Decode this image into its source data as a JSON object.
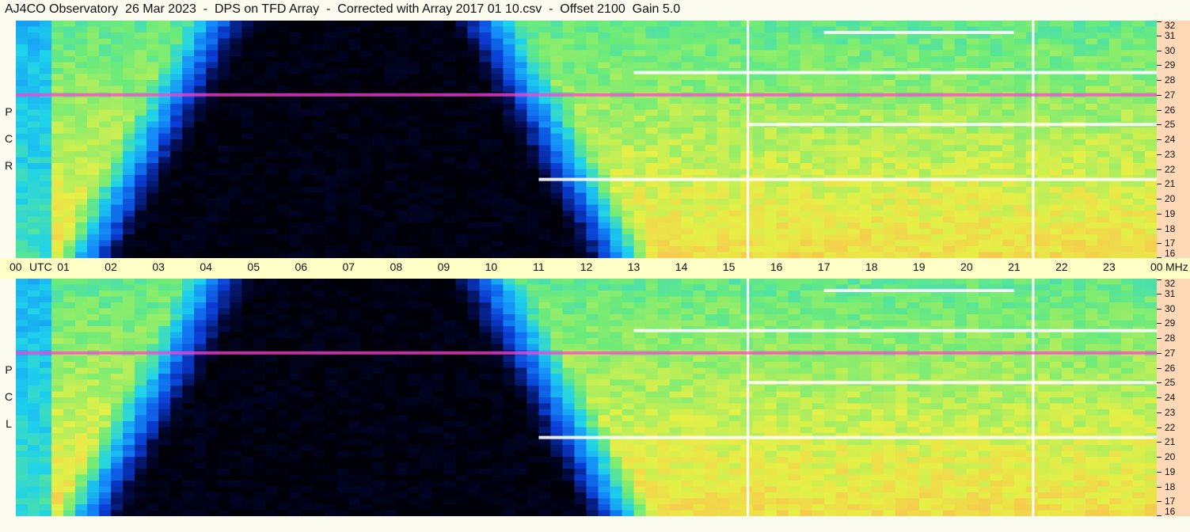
{
  "title": "AJ4CO Observatory  26 Mar 2023  -  DPS on TFD Array  -  Corrected with Array 2017 01 10.csv  -  Offset 2100  Gain 5.0",
  "colors": {
    "background": "#fbfbf0",
    "time_axis": "#ffffc8",
    "freq_axis": "#ffd8b8"
  },
  "chart_data": {
    "type": "heatmap",
    "colormap": "jet-like (black → blue → cyan → green → yellow → orange → magenta/white)",
    "x_axis": {
      "labels": [
        "00",
        "01",
        "02",
        "03",
        "04",
        "05",
        "06",
        "07",
        "08",
        "09",
        "10",
        "11",
        "12",
        "13",
        "14",
        "15",
        "16",
        "17",
        "18",
        "19",
        "20",
        "21",
        "22",
        "23",
        "00"
      ],
      "unit_label": "UTC",
      "range_hours": [
        0,
        24
      ]
    },
    "y_axis": {
      "labels": [
        "32",
        "31",
        "30",
        "29",
        "28",
        "27",
        "26",
        "25",
        "24",
        "23",
        "22",
        "21",
        "20",
        "19",
        "18",
        "17",
        "16"
      ],
      "unit_label": "MHz",
      "range_mhz": [
        16,
        32
      ]
    },
    "panels": [
      {
        "id": "rcp",
        "side_label": [
          "R",
          "C",
          "P"
        ]
      },
      {
        "id": "lcp",
        "side_label": [
          "L",
          "C",
          "P"
        ]
      }
    ],
    "features": [
      {
        "kind": "quiet_region",
        "description": "dark low-intensity region",
        "utc_start": 0.7,
        "utc_end": 13.5,
        "freq_range_mhz": [
          16,
          32
        ]
      },
      {
        "kind": "vertical_line",
        "utc": 15.4,
        "color": "white"
      },
      {
        "kind": "vertical_line",
        "utc": 21.4,
        "color": "white"
      },
      {
        "kind": "horizontal_band",
        "freq_mhz": 31.2,
        "utc_start": 17.0,
        "utc_end": 21.0,
        "color": "white"
      },
      {
        "kind": "horizontal_band",
        "freq_mhz": 28.5,
        "utc_start": 13.0,
        "utc_end": 24.0,
        "color": "white"
      },
      {
        "kind": "horizontal_band",
        "freq_mhz": 27.0,
        "utc_start": 0.0,
        "utc_end": 24.0,
        "color": "magenta"
      },
      {
        "kind": "horizontal_band",
        "freq_mhz": 25.0,
        "utc_start": 15.4,
        "utc_end": 24.0,
        "color": "white"
      },
      {
        "kind": "horizontal_band",
        "freq_mhz": 21.3,
        "utc_start": 11.0,
        "utc_end": 24.0,
        "color": "white"
      }
    ]
  },
  "panel_rcp": {
    "label_1": "R",
    "label_2": "C",
    "label_3": "P"
  },
  "panel_lcp": {
    "label_1": "L",
    "label_2": "C",
    "label_3": "P"
  }
}
